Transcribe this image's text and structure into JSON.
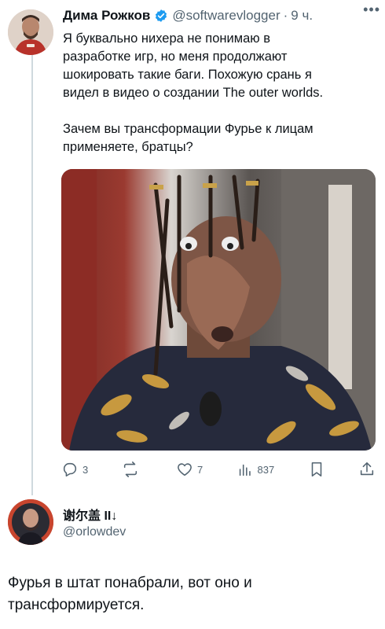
{
  "tweet": {
    "author_name": "Дима Рожков",
    "handle": "@softwarevlogger",
    "separator": "·",
    "time": "9 ч.",
    "text": "Я буквально нихера не понимаю в\nразработке игр, но меня продолжают\nшокировать такие баги. Похожую срань я\nвидел в видео о создании The outer worlds.\n\nЗачем вы трансформации Фурье к лицам\nприменяете, братцы?",
    "actions": {
      "replies": "3",
      "reposts": "",
      "likes": "7",
      "views": "837"
    }
  },
  "reply": {
    "author_name": "谢尔盖 II↓",
    "handle": "@orlowdev",
    "text": "Фурья в штат понабрали, вот оно и\nтрансформируется."
  },
  "colors": {
    "verified_blue": "#1d9bf0",
    "muted_gray": "#536471",
    "thread_line": "#cfd9de"
  }
}
